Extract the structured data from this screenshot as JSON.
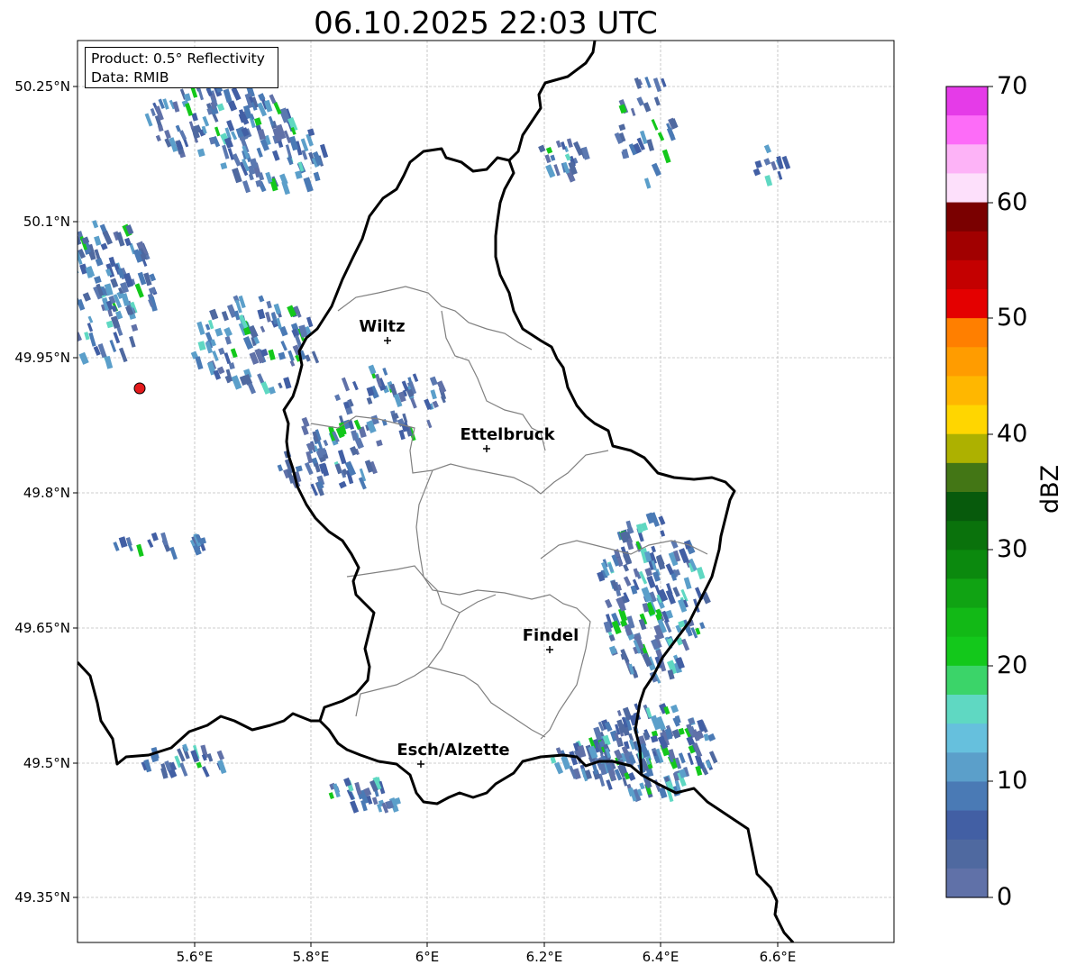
{
  "title": "06.10.2025 22:03 UTC",
  "info": {
    "product": "Product: 0.5° Reflectivity",
    "data": "Data: RMIB"
  },
  "lat_ticks": [
    "50.25°N",
    "50.1°N",
    "49.95°N",
    "49.8°N",
    "49.65°N",
    "49.5°N",
    "49.35°N"
  ],
  "lon_ticks": [
    "5.6°E",
    "5.8°E",
    "6°E",
    "6.2°E",
    "6.4°E",
    "6.6°E"
  ],
  "cities": [
    {
      "name": "Wiltz"
    },
    {
      "name": "Ettelbruck"
    },
    {
      "name": "Findel"
    },
    {
      "name": "Esch/Alzette"
    }
  ],
  "colorbar": {
    "label": "dBZ",
    "ticks": [
      "70",
      "60",
      "50",
      "40",
      "30",
      "20",
      "10",
      "0"
    ],
    "colors": [
      "#e53be8",
      "#fd6cf8",
      "#fdb3f7",
      "#fde0fb",
      "#7a0000",
      "#a10000",
      "#c40000",
      "#e40000",
      "#ff7f00",
      "#ff9c00",
      "#ffb700",
      "#ffd600",
      "#adb100",
      "#437615",
      "#075a0c",
      "#0a720c",
      "#0b890e",
      "#10a313",
      "#12b916",
      "#13c81b",
      "#3bd469",
      "#5fd8c2",
      "#66c0dd",
      "#5b9fca",
      "#4a7ab5",
      "#425fa4",
      "#4f69a0",
      "#6071a8"
    ]
  },
  "radar_site_color": "#e41a1c"
}
